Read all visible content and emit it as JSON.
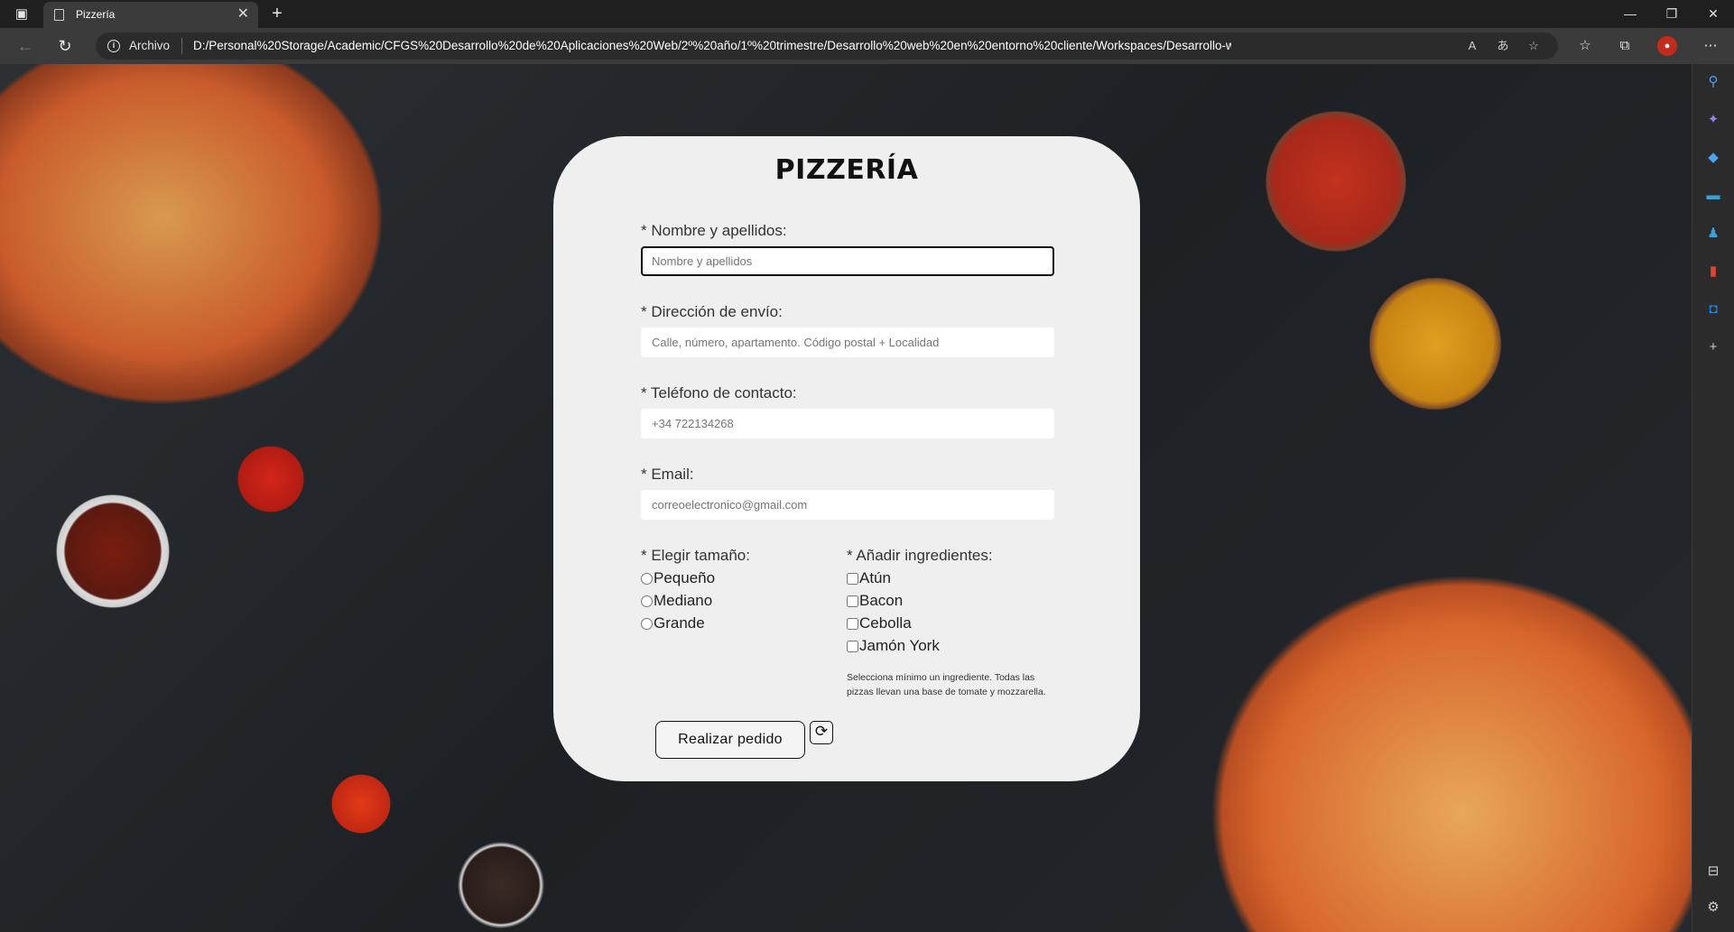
{
  "browser": {
    "tab_title": "Pizzería",
    "url_scheme": "Archivo",
    "url": "D:/Personal%20Storage/Academic/CFGS%20Desarrollo%20de%20Aplicaciones%20Web/2º%20año/1º%20trimestre/Desarrollo%20web%20en%20entorno%20cliente/Workspaces/Desarrollo-web-entorno-cliente-group/AE-2-A...",
    "accent": "#c42b1c"
  },
  "form": {
    "title": "PIZZERÍA",
    "name": {
      "label": "* Nombre y apellidos:",
      "placeholder": "Nombre y apellidos"
    },
    "address": {
      "label": "* Dirección de envío:",
      "placeholder": "Calle, número, apartamento. Código postal + Localidad"
    },
    "phone": {
      "label": "* Teléfono de contacto:",
      "placeholder": "+34 722134268"
    },
    "email": {
      "label": "* Email:",
      "placeholder": "correoelectronico@gmail.com"
    },
    "size": {
      "label": "* Elegir tamaño:",
      "options": [
        "Pequeño",
        "Mediano",
        "Grande"
      ]
    },
    "ingredients": {
      "label": "* Añadir ingredientes:",
      "options": [
        "Atún",
        "Bacon",
        "Cebolla",
        "Jamón York"
      ],
      "note": "Selecciona mínimo un ingrediente. Todas las pizzas llevan una base de tomate y mozzarella."
    },
    "submit_label": "Realizar pedido",
    "reset_icon": "refresh-icon"
  }
}
